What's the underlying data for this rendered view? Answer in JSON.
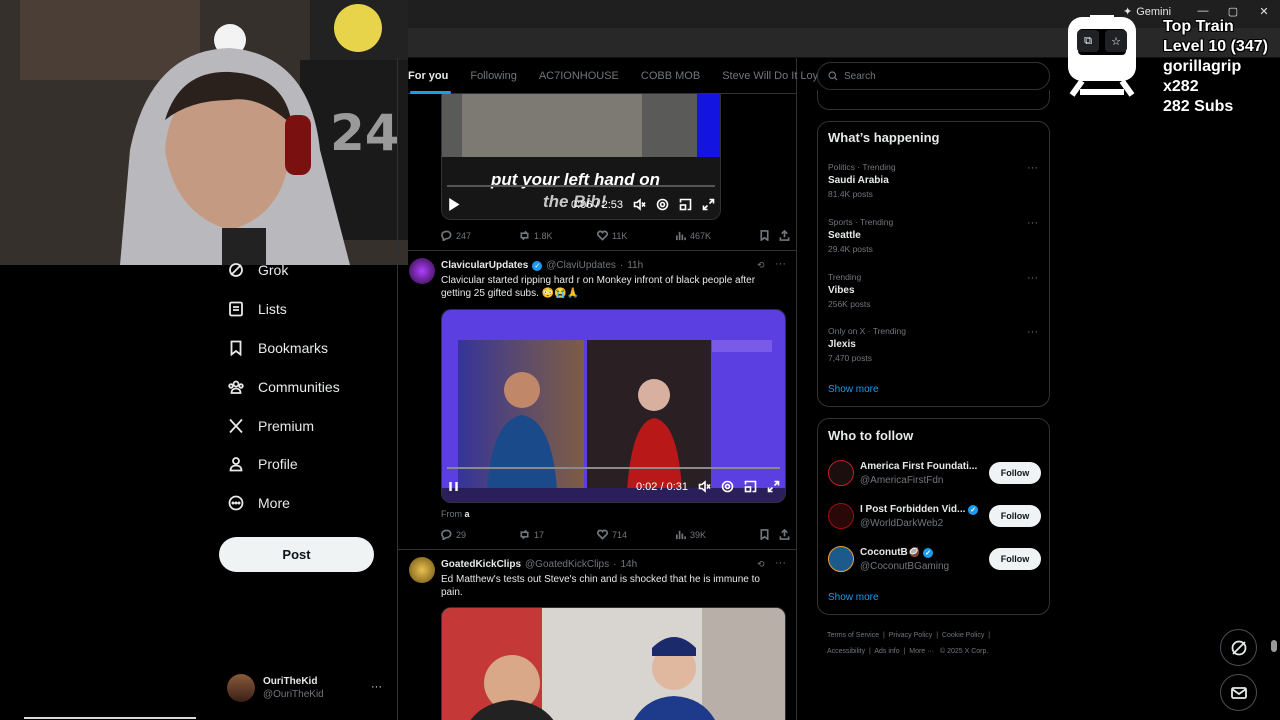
{
  "browser": {
    "gemini_label": "Gemini",
    "window_controls": [
      "—",
      "▢",
      "✕"
    ]
  },
  "nav": {
    "items": [
      {
        "label": "Grok",
        "icon": "grok-icon"
      },
      {
        "label": "Lists",
        "icon": "lists-icon"
      },
      {
        "label": "Bookmarks",
        "icon": "bookmark-icon"
      },
      {
        "label": "Communities",
        "icon": "communities-icon"
      },
      {
        "label": "Premium",
        "icon": "x-logo-icon"
      },
      {
        "label": "Profile",
        "icon": "profile-icon"
      },
      {
        "label": "More",
        "icon": "more-icon"
      }
    ],
    "post_label": "Post",
    "account": {
      "name": "OuriTheKid",
      "handle": "@OuriTheKid"
    }
  },
  "tabs": [
    "For you",
    "Following",
    "AC7IONHOUSE",
    "COBB MOB",
    "Steve Will Do It Loyal"
  ],
  "tweets": [
    {
      "caption": "put your left hand on",
      "caption2": "the Bib!",
      "time": "0:06 / 2:53",
      "stats": {
        "replies": "247",
        "reposts": "1.8K",
        "likes": "11K",
        "views": "467K"
      }
    },
    {
      "name": "ClavicularUpdates",
      "handle": "@ClaviUpdates",
      "age": "11h",
      "text": "Clavicular started ripping hard r on Monkey infront of black people after getting 25 gifted subs. 😳😭🙏",
      "time": "0:02 / 0:31",
      "from_label": "From",
      "from_value": "a",
      "stats": {
        "replies": "29",
        "reposts": "17",
        "likes": "714",
        "views": "39K"
      }
    },
    {
      "name": "GoatedKickClips",
      "handle": "@GoatedKickClips",
      "age": "14h",
      "text": "Ed Matthew's tests out Steve's chin and is shocked that he is immune to pain."
    }
  ],
  "search": {
    "placeholder": "Search"
  },
  "happening": {
    "title": "What’s happening",
    "trends": [
      {
        "category": "Politics · Trending",
        "name": "Saudi Arabia",
        "count": "81.4K posts"
      },
      {
        "category": "Sports · Trending",
        "name": "Seattle",
        "count": "29.4K posts"
      },
      {
        "category": "Trending",
        "name": "Vibes",
        "count": "256K posts"
      },
      {
        "category": "Only on X · Trending",
        "name": "Jlexis",
        "count": "7,470 posts"
      }
    ],
    "show_more": "Show more"
  },
  "who_to_follow": {
    "title": "Who to follow",
    "accounts": [
      {
        "name": "America First Foundati...",
        "handle": "@AmericaFirstFdn",
        "avatar_color": "#1a0e0e"
      },
      {
        "name": "I Post Forbidden Vid...",
        "handle": "@WorldDarkWeb2",
        "avatar_color": "#2a0808"
      },
      {
        "name": "CoconutB🥥",
        "handle": "@CoconutBGaming",
        "avatar_color": "#1d5a8c"
      }
    ],
    "follow_label": "Follow",
    "show_more": "Show more"
  },
  "footer": {
    "links": [
      "Terms of Service",
      "Privacy Policy",
      "Cookie Policy",
      "Accessibility",
      "Ads info",
      "More ···"
    ],
    "copyright": "© 2025 X Corp."
  },
  "overlay": {
    "line1": "Top Train",
    "line2": "Level 10  (347)",
    "line3": "gorillagrip x282",
    "line4": "282 Subs"
  },
  "colors": {
    "accent": "#1d9bf0",
    "border": "#2f3336",
    "muted": "#71767b"
  }
}
